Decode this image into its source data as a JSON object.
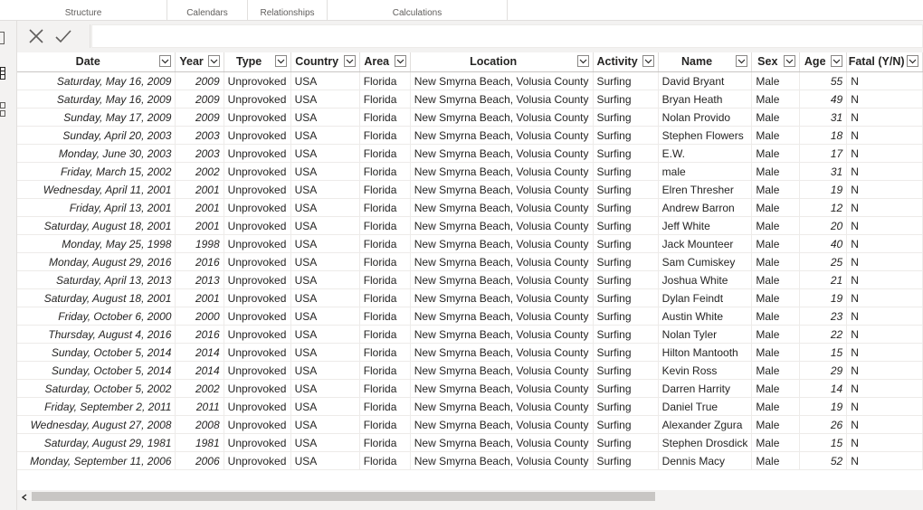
{
  "ribbon": {
    "groups": [
      {
        "label": "Structure"
      },
      {
        "label": "Calendars"
      },
      {
        "label": "Relationships"
      },
      {
        "label": "Calculations"
      }
    ]
  },
  "formula_bar": {
    "value": ""
  },
  "columns": [
    {
      "label": "Date"
    },
    {
      "label": "Year"
    },
    {
      "label": "Type"
    },
    {
      "label": "Country"
    },
    {
      "label": "Area"
    },
    {
      "label": "Location"
    },
    {
      "label": "Activity"
    },
    {
      "label": "Name"
    },
    {
      "label": "Sex"
    },
    {
      "label": "Age"
    },
    {
      "label": "Fatal (Y/N)"
    }
  ],
  "rows": [
    [
      "Saturday, May 16, 2009",
      "2009",
      "Unprovoked",
      "USA",
      "Florida",
      "New Smyrna Beach, Volusia County",
      "Surfing",
      "David Bryant",
      "Male",
      "55",
      "N"
    ],
    [
      "Saturday, May 16, 2009",
      "2009",
      "Unprovoked",
      "USA",
      "Florida",
      "New Smyrna Beach, Volusia County",
      "Surfing",
      "Bryan Heath",
      "Male",
      "49",
      "N"
    ],
    [
      "Sunday, May 17, 2009",
      "2009",
      "Unprovoked",
      "USA",
      "Florida",
      "New Smyrna Beach, Volusia County",
      "Surfing",
      "Nolan Provido",
      "Male",
      "31",
      "N"
    ],
    [
      "Sunday, April 20, 2003",
      "2003",
      "Unprovoked",
      "USA",
      "Florida",
      "New Smyrna Beach, Volusia County",
      "Surfing",
      "Stephen Flowers",
      "Male",
      "18",
      "N"
    ],
    [
      "Monday, June 30, 2003",
      "2003",
      "Unprovoked",
      "USA",
      "Florida",
      "New Smyrna Beach, Volusia County",
      "Surfing",
      "E.W.",
      "Male",
      "17",
      "N"
    ],
    [
      "Friday, March 15, 2002",
      "2002",
      "Unprovoked",
      "USA",
      "Florida",
      "New Smyrna Beach, Volusia County",
      "Surfing",
      "male",
      "Male",
      "31",
      "N"
    ],
    [
      "Wednesday, April 11, 2001",
      "2001",
      "Unprovoked",
      "USA",
      "Florida",
      "New Smyrna Beach, Volusia County",
      "Surfing",
      "Elren Thresher",
      "Male",
      "19",
      "N"
    ],
    [
      "Friday, April 13, 2001",
      "2001",
      "Unprovoked",
      "USA",
      "Florida",
      "New Smyrna Beach, Volusia County",
      "Surfing",
      "Andrew Barron",
      "Male",
      "12",
      "N"
    ],
    [
      "Saturday, August 18, 2001",
      "2001",
      "Unprovoked",
      "USA",
      "Florida",
      "New Smyrna Beach, Volusia County",
      "Surfing",
      "Jeff White",
      "Male",
      "20",
      "N"
    ],
    [
      "Monday, May 25, 1998",
      "1998",
      "Unprovoked",
      "USA",
      "Florida",
      "New Smyrna Beach, Volusia County",
      "Surfing",
      "Jack Mounteer",
      "Male",
      "40",
      "N"
    ],
    [
      "Monday, August 29, 2016",
      "2016",
      "Unprovoked",
      "USA",
      "Florida",
      "New Smyrna Beach, Volusia County",
      "Surfing",
      "Sam Cumiskey",
      "Male",
      "25",
      "N"
    ],
    [
      "Saturday, April 13, 2013",
      "2013",
      "Unprovoked",
      "USA",
      "Florida",
      "New Smyrna Beach, Volusia County",
      "Surfing",
      "Joshua White",
      "Male",
      "21",
      "N"
    ],
    [
      "Saturday, August 18, 2001",
      "2001",
      "Unprovoked",
      "USA",
      "Florida",
      "New Smyrna Beach, Volusia County",
      "Surfing",
      "Dylan Feindt",
      "Male",
      "19",
      "N"
    ],
    [
      "Friday, October 6, 2000",
      "2000",
      "Unprovoked",
      "USA",
      "Florida",
      "New Smyrna Beach, Volusia County",
      "Surfing",
      "Austin White",
      "Male",
      "23",
      "N"
    ],
    [
      "Thursday, August 4, 2016",
      "2016",
      "Unprovoked",
      "USA",
      "Florida",
      "New Smyrna Beach, Volusia County",
      "Surfing",
      "Nolan Tyler",
      "Male",
      "22",
      "N"
    ],
    [
      "Sunday, October 5, 2014",
      "2014",
      "Unprovoked",
      "USA",
      "Florida",
      "New Smyrna Beach, Volusia County",
      "Surfing",
      "Hilton Mantooth",
      "Male",
      "15",
      "N"
    ],
    [
      "Sunday, October 5, 2014",
      "2014",
      "Unprovoked",
      "USA",
      "Florida",
      "New Smyrna Beach, Volusia County",
      "Surfing",
      "Kevin Ross",
      "Male",
      "29",
      "N"
    ],
    [
      "Saturday, October 5, 2002",
      "2002",
      "Unprovoked",
      "USA",
      "Florida",
      "New Smyrna Beach, Volusia County",
      "Surfing",
      "Darren Harrity",
      "Male",
      "14",
      "N"
    ],
    [
      "Friday, September 2, 2011",
      "2011",
      "Unprovoked",
      "USA",
      "Florida",
      "New Smyrna Beach, Volusia County",
      "Surfing",
      "Daniel True",
      "Male",
      "19",
      "N"
    ],
    [
      "Wednesday, August 27, 2008",
      "2008",
      "Unprovoked",
      "USA",
      "Florida",
      "New Smyrna Beach, Volusia County",
      "Surfing",
      "Alexander Zgura",
      "Male",
      "26",
      "N"
    ],
    [
      "Saturday, August 29, 1981",
      "1981",
      "Unprovoked",
      "USA",
      "Florida",
      "New Smyrna Beach, Volusia County",
      "Surfing",
      "Stephen Drosdick",
      "Male",
      "15",
      "N"
    ],
    [
      "Monday, September 11, 2006",
      "2006",
      "Unprovoked",
      "USA",
      "Florida",
      "New Smyrna Beach, Volusia County",
      "Surfing",
      "Dennis Macy",
      "Male",
      "52",
      "N"
    ]
  ],
  "icons": {
    "cancel": "close-icon",
    "commit": "checkmark-icon",
    "filter": "chevron-down-icon",
    "scroll_left": "chevron-left-icon"
  },
  "colors": {
    "header_border": "#c8c6c4",
    "grid_line": "#edebe9",
    "scroll_thumb": "#c8c6c4"
  }
}
